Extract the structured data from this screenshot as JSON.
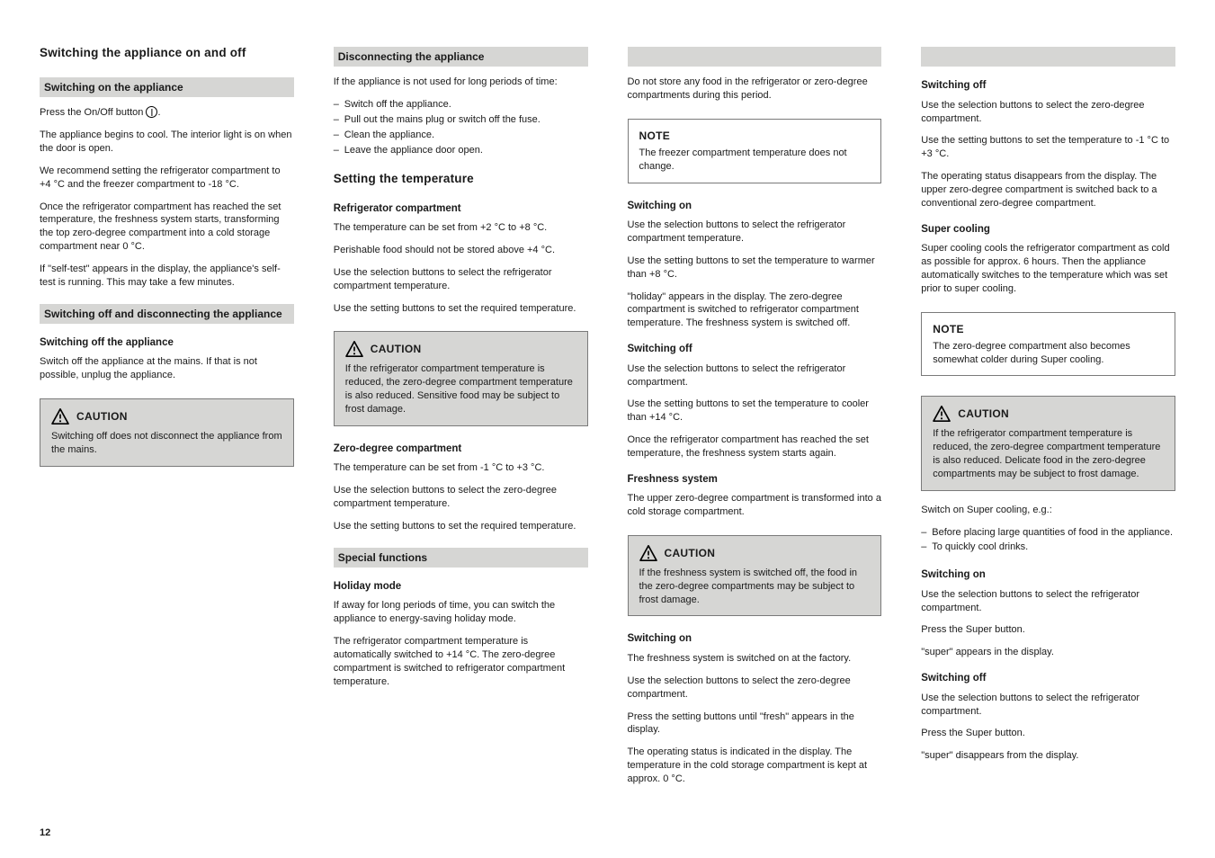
{
  "col1": {
    "h_main": "Switching the appliance on and off",
    "bar_on": "Switching on the appliance",
    "on_p1": "Press the On/Off button",
    "on_p1_after": ".",
    "on_p2": "The appliance begins to cool. The interior light is on when the door is open.",
    "on_p3": "We recommend setting the refrigerator compartment to +4 °C and the freezer compartment to -18 °C.",
    "on_p4": "Once the refrigerator compartment has reached the set temperature, the freshness system starts, transforming the top zero-degree compartment into a cold storage compartment near 0 °C.",
    "on_p5": "If \"self-test\" appears in the display, the appliance's self-test is running. This may take a few minutes.",
    "bar_off": "Switching off and disconnecting the appliance",
    "sub_off": "Switching off the appliance",
    "off_p": "Switch off the appliance at the mains. If that is not possible, unplug the appliance.",
    "caution_off": {
      "title": "CAUTION",
      "text": "Switching off does not disconnect the appliance from the mains."
    }
  },
  "col2": {
    "sub_disc": "Disconnecting the appliance",
    "disc_p1": "If the appliance is not used for long periods of time:",
    "disc_list": [
      "Switch off the appliance.",
      "Pull out the mains plug or switch off the fuse.",
      "Clean the appliance.",
      "Leave the appliance door open."
    ],
    "bar_temp": "Setting the temperature",
    "sub_ref": "Refrigerator compartment",
    "ref_p1": "The temperature can be set from +2 °C to +8 °C.",
    "ref_p2": "Perishable food should not be stored above +4 °C.",
    "ref_p3": "Use the selection buttons to select the refrigerator compartment temperature.",
    "ref_p4": "Use the setting buttons to set the required temperature.",
    "caution_ref": {
      "title": "CAUTION",
      "text": "If the refrigerator compartment temperature is reduced, the zero-degree compartment temperature is also reduced. Sensitive food may be subject to frost damage."
    },
    "sub_zero": "Zero-degree compartment",
    "zero_p1": "The temperature can be set from -1 °C to +3 °C.",
    "zero_p2": "Use the selection buttons to select the zero-degree compartment temperature.",
    "zero_p3": "Use the setting buttons to set the required temperature.",
    "bar_special": "Special functions",
    "sub_holiday": "Holiday mode",
    "hol_p1": "If away for long periods of time, you can switch the appliance to energy-saving holiday mode.",
    "hol_p2": "The refrigerator compartment temperature is automatically switched to +14 °C. The zero-degree compartment is switched to refrigerator compartment temperature."
  },
  "col3": {
    "bar_cont": "",
    "p1": "Do not store any food in the refrigerator or zero-degree compartments during this period.",
    "note1": {
      "title": "NOTE",
      "text": "The freezer compartment temperature does not change."
    },
    "sub_hon": "Switching on",
    "hon_p1": "Use the selection buttons to select the refrigerator compartment temperature.",
    "hon_p2": "Use the setting buttons to set the temperature to warmer than +8 °C.",
    "hon_p3": "\"holiday\" appears in the display. The zero-degree compartment is switched to refrigerator compartment temperature. The freshness system is switched off.",
    "sub_hoff": "Switching off",
    "hoff_p1": "Use the selection buttons to select the refrigerator compartment.",
    "hoff_p2": "Use the setting buttons to set the temperature to cooler than +14 °C.",
    "hoff_p3": "Once the refrigerator compartment has reached the set temperature, the freshness system starts again.",
    "sub_fresh": "Freshness system",
    "fresh_p1": "The upper zero-degree compartment is transformed into a cold storage compartment.",
    "caution_fresh": {
      "title": "CAUTION",
      "text": "If the freshness system is switched off, the food in the zero-degree compartments may be subject to frost damage."
    },
    "sub_fon": "Switching on",
    "fon_p1": "The freshness system is switched on at the factory.",
    "fon_p2": "Use the selection buttons to select the zero-degree compartment.",
    "fon_p3": "Press the setting buttons until \"fresh\" appears in the display.",
    "fon_p4": "The operating status is indicated in the display. The temperature in the cold storage compartment is kept at approx. 0 °C."
  },
  "col4": {
    "bar_cont": "",
    "sub_foff": "Switching off",
    "foff_p1": "Use the selection buttons to select the zero-degree compartment.",
    "foff_p2": "Use the setting buttons to set the temperature to -1 °C to +3 °C.",
    "foff_p3": "The operating status disappears from the display. The upper zero-degree compartment is switched back to a conventional zero-degree compartment.",
    "sub_super": "Super cooling",
    "super_p1": "Super cooling cools the refrigerator compartment as cold as possible for approx. 6 hours. Then the appliance automatically switches to the temperature which was set prior to super cooling.",
    "note2": {
      "title": "NOTE",
      "text": "The zero-degree compartment also becomes somewhat colder during Super cooling."
    },
    "caution_super": {
      "title": "CAUTION",
      "text": "If the refrigerator compartment temperature is reduced, the zero-degree compartment temperature is also reduced. Delicate food in the zero-degree compartments may be subject to frost damage."
    },
    "super_p2": "Switch on Super cooling, e.g.:",
    "super_list": [
      "Before placing large quantities of food in the appliance.",
      "To quickly cool drinks."
    ],
    "sub_son": "Switching on",
    "son_p1": "Use the selection buttons to select the refrigerator compartment.",
    "son_p2": "Press the Super button.",
    "son_p3": "\"super\" appears in the display.",
    "sub_soff": "Switching off",
    "soff_p1": "Use the selection buttons to select the refrigerator compartment.",
    "soff_p2": "Press the Super button.",
    "soff_p3": "\"super\" disappears from the display."
  },
  "footer": {
    "page": "12",
    "meta": ""
  }
}
